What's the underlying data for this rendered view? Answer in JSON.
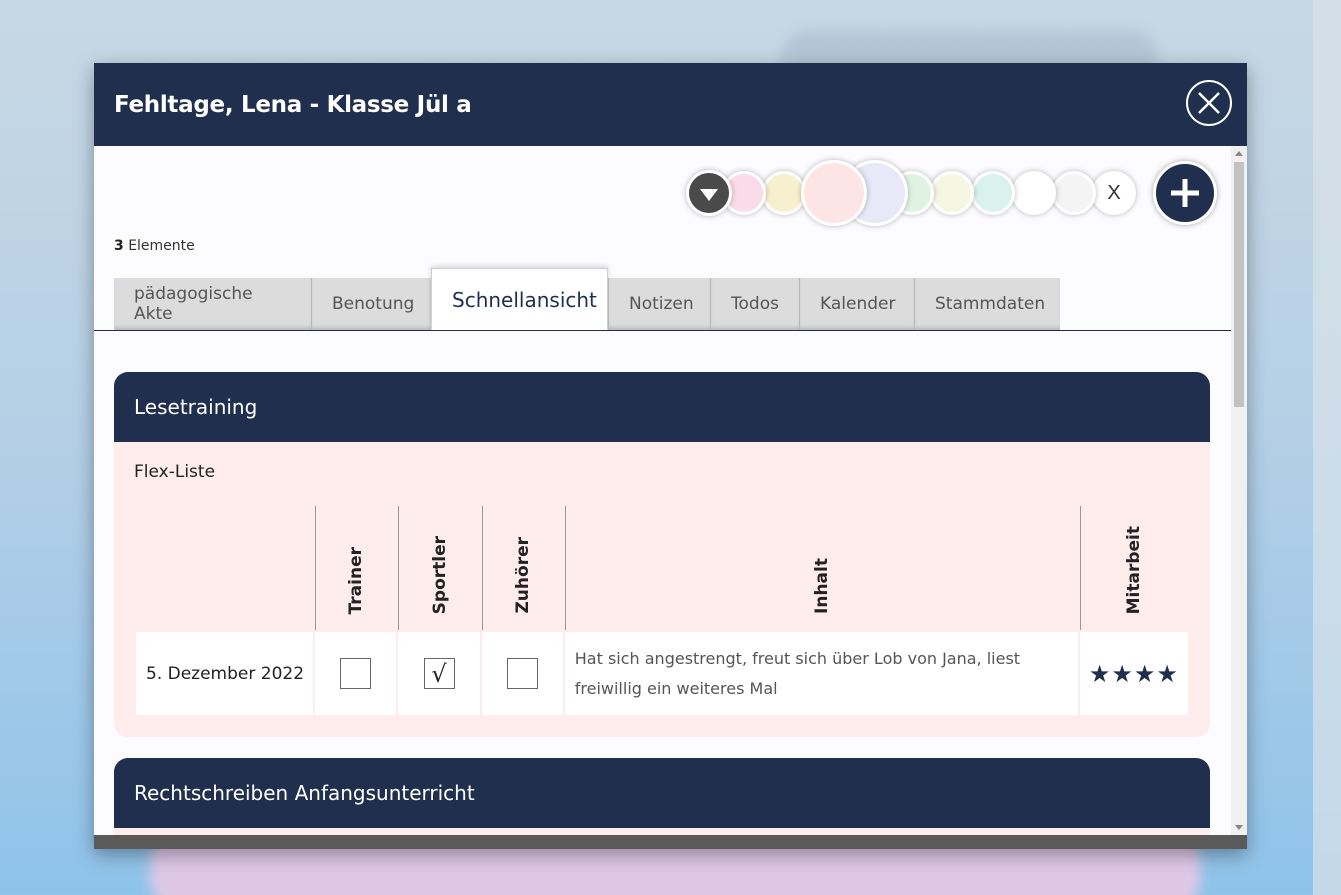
{
  "modal": {
    "title": "Fehltage, Lena - Klasse Jül a"
  },
  "colors": {
    "header": "#1f2f4d",
    "swatches": [
      "#fadbe8",
      "#f7f0cf",
      "#fde5e6",
      "#e8e8f8",
      "#e0f3e3",
      "#f5f7e3",
      "#d9f3ec",
      "#ffffff",
      "#f4f4f4"
    ]
  },
  "color_bar": {
    "clear_label": "X"
  },
  "elements": {
    "count": "3",
    "label": " Elemente"
  },
  "tabs": [
    {
      "label": "pädagogische Akte",
      "active": false
    },
    {
      "label": "Benotung",
      "active": false
    },
    {
      "label": "Schnellansicht",
      "active": true
    },
    {
      "label": "Notizen",
      "active": false
    },
    {
      "label": "Todos",
      "active": false
    },
    {
      "label": "Kalender",
      "active": false
    },
    {
      "label": "Stammdaten",
      "active": false
    }
  ],
  "sections": [
    {
      "title": "Lesetraining",
      "list_label": "Flex-Liste",
      "columns": [
        "Trainer",
        "Sportler",
        "Zuhörer",
        "Inhalt",
        "Mitarbeit"
      ],
      "rows": [
        {
          "date": "5. Dezember 2022",
          "trainer": "",
          "sportler": "√",
          "zuhoerer": "",
          "inhalt": "Hat sich angestrengt, freut sich über Lob von Jana, liest freiwillig ein weiteres Mal",
          "mitarbeit": "★★★★"
        }
      ]
    },
    {
      "title": "Rechtschreiben Anfangsunterricht"
    }
  ]
}
